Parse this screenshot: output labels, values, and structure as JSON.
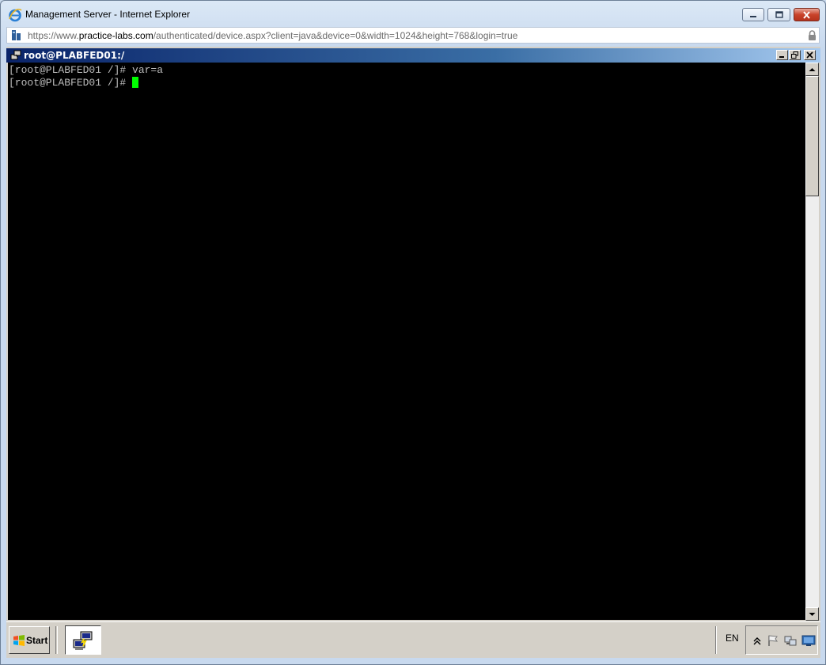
{
  "browser": {
    "window_title": "Management Server - Internet Explorer",
    "url_prefix": "https://www.",
    "url_domain": "practice-labs.com",
    "url_path": "/authenticated/device.aspx?client=java&device=0&width=1024&height=768&login=true"
  },
  "session": {
    "window_title": "root@PLABFED01:/"
  },
  "terminal": {
    "lines": [
      "[root@PLABFED01 /]# var=a",
      "[root@PLABFED01 /]# "
    ],
    "cursor_color": "#00ff00"
  },
  "taskbar": {
    "start_label": "Start",
    "language": "EN"
  },
  "icons": {
    "ie_logo": "internet-explorer-icon",
    "page_icon": "page-icon",
    "lock": "lock-icon",
    "putty": "putty-icon",
    "start": "windows-logo-icon",
    "task": "putty-task-icon",
    "tray": [
      "show-hidden-icons-icon",
      "action-center-flag-icon",
      "network-icon",
      "show-desktop-icon"
    ]
  },
  "colors": {
    "session_title_start": "#0a246a",
    "session_title_end": "#a6caf0",
    "terminal_bg": "#000000",
    "terminal_fg": "#bbbbbb"
  }
}
